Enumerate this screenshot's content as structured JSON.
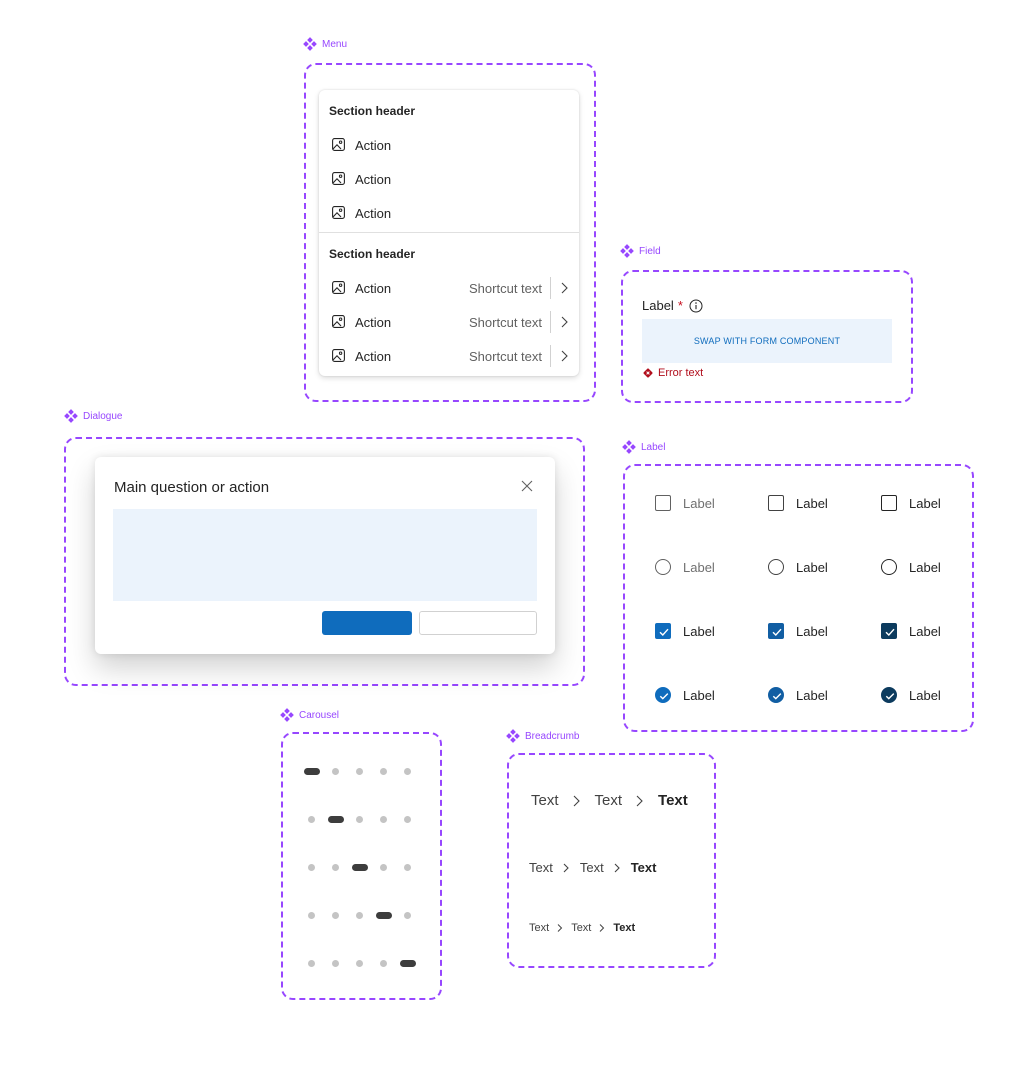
{
  "components": {
    "menu": "Menu",
    "field": "Field",
    "dialogue": "Dialogue",
    "label": "Label",
    "carousel": "Carousel",
    "breadcrumb": "Breadcrumb"
  },
  "menu": {
    "sections": [
      {
        "header": "Section header",
        "items": [
          {
            "label": "Action",
            "icon": "image-icon"
          },
          {
            "label": "Action",
            "icon": "image-icon"
          },
          {
            "label": "Action",
            "icon": "image-icon"
          }
        ]
      },
      {
        "header": "Section header",
        "items": [
          {
            "label": "Action",
            "shortcut": "Shortcut text",
            "icon": "image-icon",
            "submenu": "chevron-right-icon"
          },
          {
            "label": "Action",
            "shortcut": "Shortcut text",
            "icon": "image-icon",
            "submenu": "chevron-right-icon"
          },
          {
            "label": "Action",
            "shortcut": "Shortcut text",
            "icon": "image-icon",
            "submenu": "chevron-right-icon"
          }
        ]
      }
    ]
  },
  "field": {
    "label": "Label",
    "required_mark": "*",
    "info_icon": "info-icon",
    "placeholder_text": "SWAP WITH FORM COMPONENT",
    "error_text": "Error text",
    "error_icon": "error-icon"
  },
  "dialog": {
    "title": "Main question or action",
    "close_icon": "close-icon"
  },
  "label_grid": {
    "label": "Label",
    "rows": [
      {
        "control": "checkbox",
        "checked": false
      },
      {
        "control": "radio",
        "checked": false
      },
      {
        "control": "checkbox",
        "checked": true
      },
      {
        "control": "radio",
        "checked": true
      }
    ]
  },
  "carousel": {
    "dot_count": 5,
    "active_positions": [
      1,
      2,
      3,
      4,
      5
    ]
  },
  "breadcrumb": {
    "rows": [
      {
        "size": "large",
        "items": [
          "Text",
          "Text",
          "Text"
        ]
      },
      {
        "size": "medium",
        "items": [
          "Text",
          "Text",
          "Text"
        ]
      },
      {
        "size": "small",
        "items": [
          "Text",
          "Text",
          "Text"
        ]
      }
    ]
  },
  "colors": {
    "component_outline": "#9747ff",
    "brand": "#0f6cbd",
    "brand_background": "#ebf3fc",
    "error": "#b10e1c",
    "carousel_active": "#3d3d3d",
    "carousel_inactive": "#c4c4c4"
  }
}
